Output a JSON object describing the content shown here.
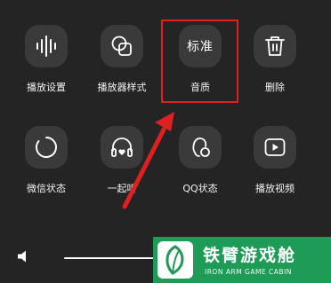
{
  "options": [
    {
      "label": "播放设置",
      "icon": "sound-wave-icon"
    },
    {
      "label": "播放器样式",
      "icon": "overlapping-shapes-icon"
    },
    {
      "label": "音质",
      "icon": "quality-text-icon",
      "tile_text": "标准"
    },
    {
      "label": "删除",
      "icon": "trash-icon"
    },
    {
      "label": "微信状态",
      "icon": "circle-status-icon"
    },
    {
      "label": "一起听",
      "icon": "headphones-heart-icon"
    },
    {
      "label": "QQ状态",
      "icon": "qq-status-icon"
    },
    {
      "label": "播放视频",
      "icon": "play-video-icon"
    }
  ],
  "volume": {
    "icon": "speaker-icon"
  },
  "annotation": {
    "highlight_color": "#e02020"
  },
  "watermark": {
    "title": "铁臂游戏舱",
    "subtitle": "IRON ARM GAME CABIN",
    "color": "#1e9b57"
  }
}
